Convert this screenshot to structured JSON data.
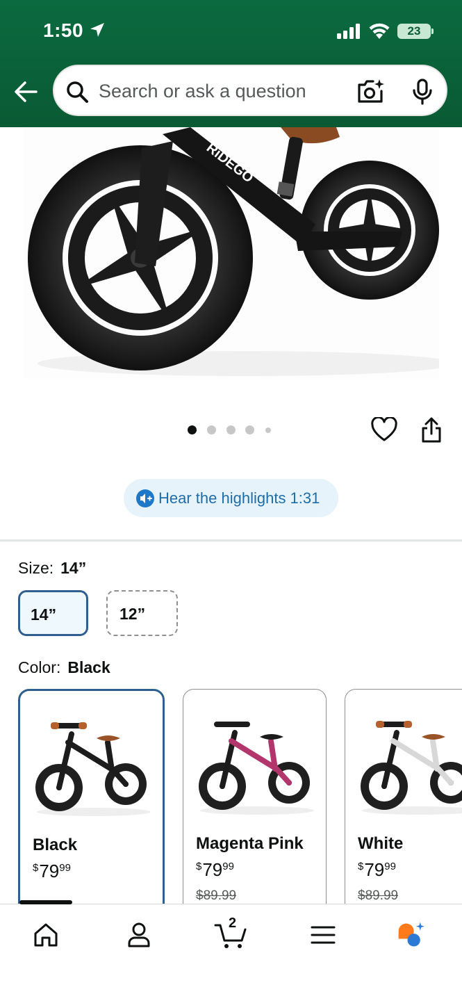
{
  "status_bar": {
    "time": "1:50",
    "battery": "23"
  },
  "header": {
    "search_placeholder": "Search or ask a question",
    "icons": [
      "back-arrow-icon",
      "search-icon",
      "camera-icon",
      "mic-icon"
    ],
    "background_color": "#0b6a3f"
  },
  "product_image": {
    "brand_text": "RiDEGO",
    "dot_count": 5,
    "active_dot": 0
  },
  "hear_highlights": {
    "label": "Hear the highlights 1:31"
  },
  "size": {
    "label": "Size:",
    "selected": "14”",
    "options": [
      {
        "label": "14”",
        "selected": true
      },
      {
        "label": "12”",
        "selected": false
      }
    ]
  },
  "color": {
    "label": "Color:",
    "selected": "Black",
    "options": [
      {
        "name": "Black",
        "price_whole": "79",
        "price_fraction": "99",
        "list_price": "",
        "frame_color": "#1c1c1c"
      },
      {
        "name": "Magenta Pink",
        "price_whole": "79",
        "price_fraction": "99",
        "list_price": "$89.99",
        "frame_color": "#b2356c"
      },
      {
        "name": "White",
        "price_whole": "79",
        "price_fraction": "99",
        "list_price": "$89.99",
        "frame_color": "#e9e9e9"
      }
    ],
    "currency": "$"
  },
  "bottom_nav": {
    "cart_count": "2",
    "items": [
      "home",
      "account",
      "cart",
      "menu",
      "rufus"
    ]
  }
}
